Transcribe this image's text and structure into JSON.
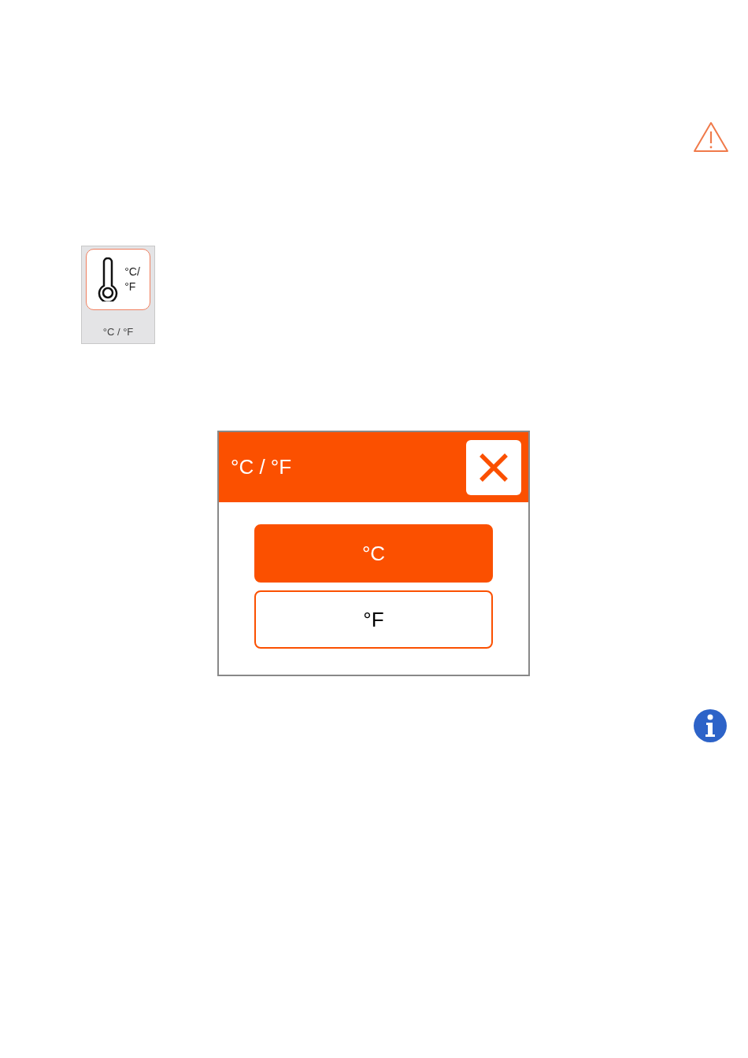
{
  "tile": {
    "icon_lines": [
      "°C/",
      "°F"
    ],
    "label": "°C / °F"
  },
  "dialog": {
    "title": "°C / °F",
    "options": [
      {
        "label": "°C",
        "selected": true
      },
      {
        "label": "°F",
        "selected": false
      }
    ]
  }
}
